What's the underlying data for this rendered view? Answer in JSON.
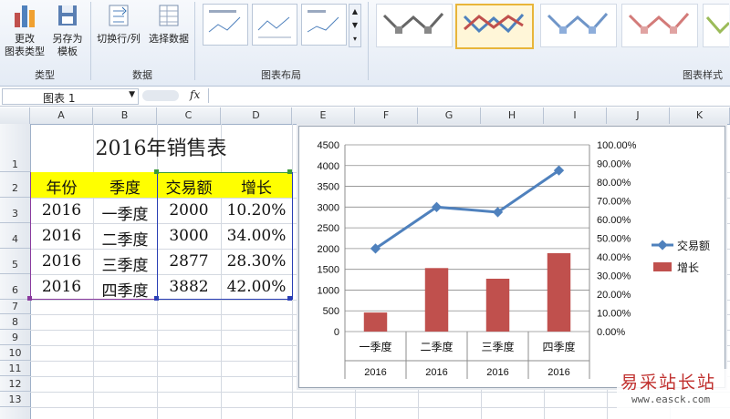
{
  "ribbon": {
    "change_type_label": "更改\n图表类型",
    "save_template_label": "另存为\n模板",
    "type_group": "类型",
    "switch_label": "切换行/列",
    "select_data_label": "选择数据",
    "data_group": "数据",
    "layout_group": "图表布局",
    "style_group": "图表样式"
  },
  "formula_bar": {
    "name_box": "图表 1",
    "fx": "fx",
    "formula": ""
  },
  "columns": [
    "A",
    "B",
    "C",
    "D",
    "E",
    "F",
    "G",
    "H",
    "I",
    "J",
    "K"
  ],
  "rows": [
    "1",
    "2",
    "3",
    "4",
    "5",
    "6",
    "7",
    "8",
    "9",
    "10",
    "11",
    "12",
    "13"
  ],
  "sheet": {
    "title": "2016年销售表",
    "headers": [
      "年份",
      "季度",
      "交易额",
      "增长"
    ],
    "data": [
      [
        "2016",
        "一季度",
        "2000",
        "10.20%"
      ],
      [
        "2016",
        "二季度",
        "3000",
        "34.00%"
      ],
      [
        "2016",
        "三季度",
        "2877",
        "28.30%"
      ],
      [
        "2016",
        "四季度",
        "3882",
        "42.00%"
      ]
    ]
  },
  "colors": {
    "line": "#4f81bd",
    "bar": "#c0504d",
    "header_bg": "#ffff00"
  },
  "chart_data": {
    "type": "bar+line",
    "categories": [
      "一季度",
      "二季度",
      "三季度",
      "四季度"
    ],
    "category_group": "2016",
    "series": [
      {
        "name": "交易额",
        "type": "line",
        "axis": "left",
        "values": [
          2000,
          3000,
          2877,
          3882
        ]
      },
      {
        "name": "增长",
        "type": "bar",
        "axis": "right",
        "values": [
          0.102,
          0.34,
          0.283,
          0.42
        ]
      }
    ],
    "y_left": {
      "min": 0,
      "max": 4500,
      "ticks": [
        "0",
        "500",
        "1000",
        "1500",
        "2000",
        "2500",
        "3000",
        "3500",
        "4000",
        "4500"
      ]
    },
    "y_right": {
      "min": 0,
      "max": 1,
      "ticks": [
        "0.00%",
        "10.00%",
        "20.00%",
        "30.00%",
        "40.00%",
        "50.00%",
        "60.00%",
        "70.00%",
        "80.00%",
        "90.00%",
        "100.00%"
      ]
    },
    "legend": "right",
    "grid": true
  },
  "watermark": {
    "text": "易采站长站",
    "url": "www.easck.com"
  }
}
